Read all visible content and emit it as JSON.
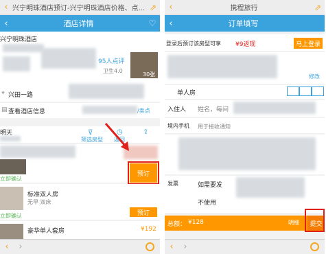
{
  "left": {
    "page_title": "兴宁明珠酒店预订-兴宁明珠酒店价格、点...",
    "nav_title": "酒店详情",
    "hotel_name": "兴宁明珠酒店",
    "reviews": "95人点评",
    "hygiene": "卫生4.0",
    "photo_count": "30张",
    "address": "兴田一路",
    "view_info": "查看酒店信息",
    "facilities": "/卖点",
    "checkin": "明天",
    "filter_room": "筛选房型",
    "filter_other": "返回",
    "confirm_now": "立即确认",
    "book_button": "预订",
    "room2_name": "标准双人房",
    "room2_detail": "无早  双床",
    "confirm_now2": "立即确认",
    "book_button2": "预订",
    "room3_name": "豪华单人套房",
    "price3": "¥192"
  },
  "right": {
    "page_title": "携程旅行",
    "nav_title": "订单填写",
    "login_promo_prefix": "登录后预订该房型可享",
    "login_promo_amount": "¥9返现",
    "login_button": "马上登录",
    "modify": "修改",
    "room_name": "单人房",
    "guest_label": "入住人",
    "guest_placeholder": "姓名，每间",
    "phone_label": "境内手机",
    "phone_placeholder": "用于接收通知",
    "invoice_label": "发票",
    "invoice_need": "如需要发",
    "invoice_none": "不使用",
    "total_label": "总额：",
    "total_amount": "¥128",
    "detail_label": "明细",
    "submit_button": "提交"
  }
}
